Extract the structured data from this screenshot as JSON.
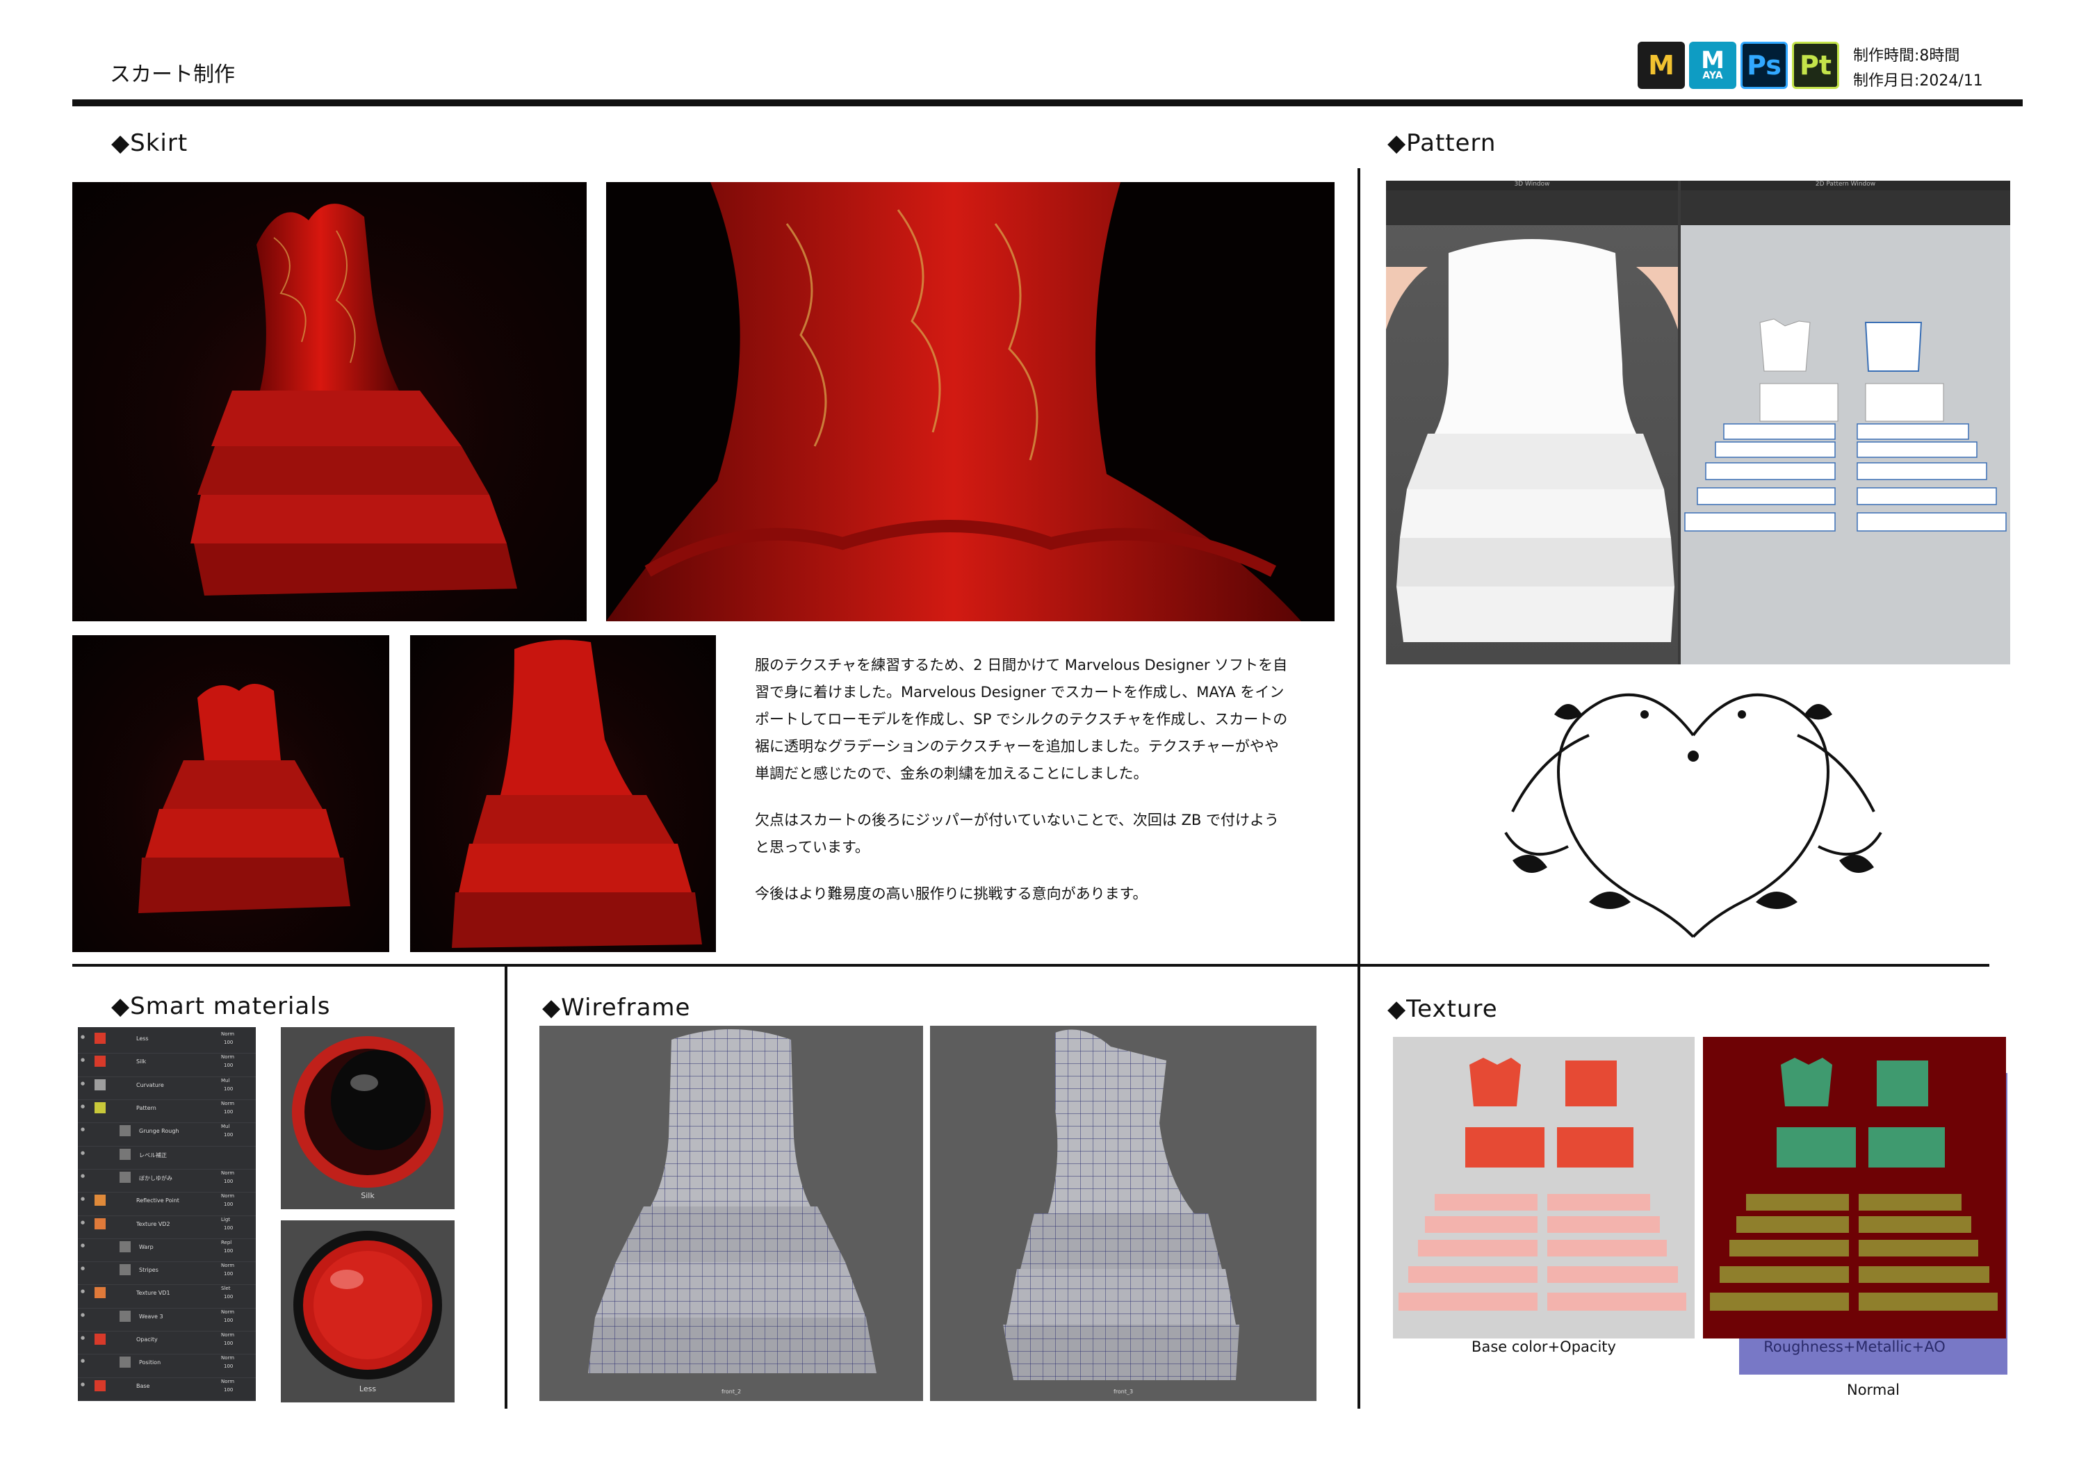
{
  "header": {
    "title": "スカート制作",
    "production_time": "制作時間:8時間",
    "production_date": "制作月日:2024/11",
    "app_icons": [
      {
        "name": "marvelous-designer-icon",
        "glyph": "M",
        "color": "#f2c230",
        "bg": "#1b1b1b"
      },
      {
        "name": "maya-icon",
        "glyph": "M",
        "sub": "AYA",
        "color": "#ffffff",
        "bg": "#0e9cc3"
      },
      {
        "name": "photoshop-icon",
        "glyph": "Ps",
        "color": "#31a8ff",
        "bg": "#001e36"
      },
      {
        "name": "substance-painter-icon",
        "glyph": "Pt",
        "color": "#c4e44a",
        "bg": "#1e2a16"
      }
    ]
  },
  "sections": {
    "skirt": "◆Skirt",
    "pattern": "◆Pattern",
    "smart_materials": "◆Smart materials",
    "wireframe": "◆Wireframe",
    "texture": "◆Texture"
  },
  "description": {
    "p1": "服のテクスチャを練習するため、2 日間かけて Marvelous Designer ソフトを自習で身に着けました。Marvelous Designer でスカートを作成し、MAYA をインポートしてローモデルを作成し、SP でシルクのテクスチャを作成し、スカートの裾に透明なグラデーションのテクスチャーを追加しました。テクスチャーがやや単調だと感じたので、金糸の刺繍を加えることにしました。",
    "p2": "欠点はスカートの後ろにジッパーが付いていないことで、次回は ZB で付けようと思っています。",
    "p3": "今後はより難易度の高い服作りに挑戦する意向があります。"
  },
  "pattern_window": {
    "left_title": "3D Window",
    "right_title": "2D Pattern Window"
  },
  "layers": [
    {
      "name": "Less",
      "blend": "Norm",
      "opacity": "100"
    },
    {
      "name": "Silk",
      "blend": "Norm",
      "opacity": "100"
    },
    {
      "name": "Curvature",
      "blend": "Mul",
      "opacity": "100"
    },
    {
      "name": "Pattern",
      "blend": "Norm",
      "opacity": "100"
    },
    {
      "name": "Grunge Rough",
      "blend": "Mul",
      "opacity": "100"
    },
    {
      "name": "レベル補正",
      "blend": "",
      "opacity": ""
    },
    {
      "name": "ぼかしゆがみ",
      "blend": "Norm",
      "opacity": "100"
    },
    {
      "name": "Reflective Point",
      "blend": "Norm",
      "opacity": "100"
    },
    {
      "name": "Texture VD2",
      "blend": "Ligt",
      "opacity": "100"
    },
    {
      "name": "Warp",
      "blend": "Repl",
      "opacity": "100"
    },
    {
      "name": "Stripes",
      "blend": "Norm",
      "opacity": "100"
    },
    {
      "name": "Texture VD1",
      "blend": "Slet",
      "opacity": "100"
    },
    {
      "name": "Weave 3",
      "blend": "Norm",
      "opacity": "100"
    },
    {
      "name": "Opacity",
      "blend": "Norm",
      "opacity": "100"
    },
    {
      "name": "Position",
      "blend": "Norm",
      "opacity": "100"
    },
    {
      "name": "Base",
      "blend": "Norm",
      "opacity": "100"
    }
  ],
  "material_balls": {
    "top": "Silk",
    "bottom": "Less"
  },
  "wireframe_labels": {
    "front": "front_2",
    "side": "front_3"
  },
  "texture_captions": {
    "base": "Base color+Opacity",
    "rough": "Roughness+Metallic+AO",
    "normal": "Normal"
  },
  "colors": {
    "dress_red": "#c9140f",
    "dress_gold": "#d7a24a",
    "normal_map": "#7878c6",
    "rough_bg": "#6e0205"
  }
}
